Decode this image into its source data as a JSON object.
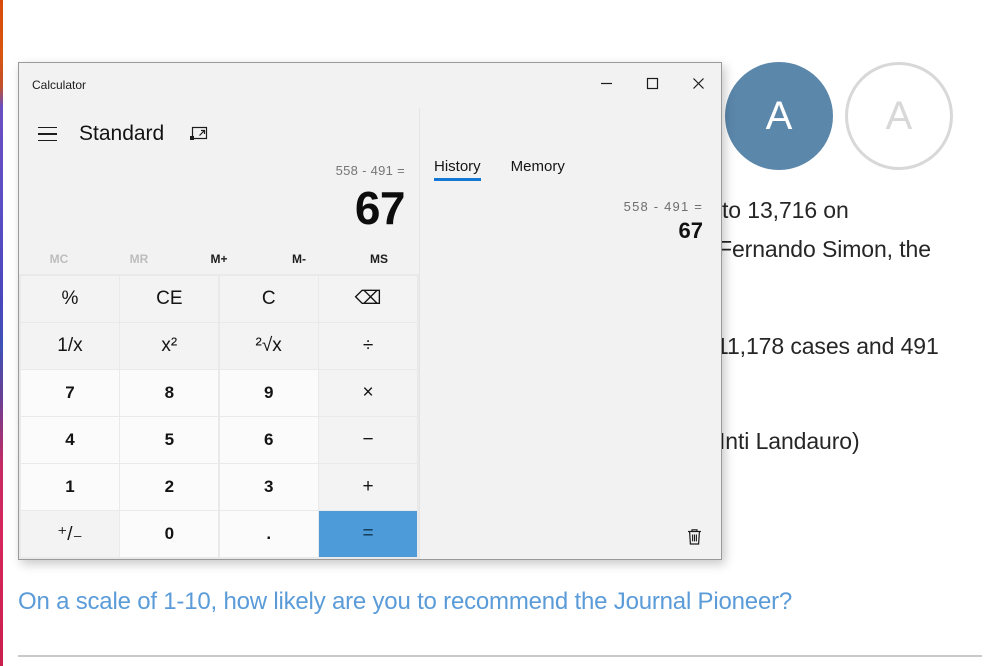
{
  "background": {
    "avatars": [
      {
        "initial": "A",
        "style": "filled"
      },
      {
        "initial": "A",
        "style": "outline"
      }
    ],
    "article_lines": [
      "to 13,716 on",
      "Fernando Simon, the",
      "11,178 cases and 491",
      "Inti Landauro)"
    ],
    "survey_question": "On a scale of 1-10, how likely are you to recommend the Journal Pioneer?",
    "accent_blue": "#5a9bd8"
  },
  "calculator": {
    "window_caption": "Calculator",
    "window_controls": {
      "minimize": "minimize-icon",
      "maximize": "maximize-icon",
      "close": "close-icon"
    },
    "menu_icon": "hamburger-menu-icon",
    "mode": "Standard",
    "keypad_toggle_icon": "keypad-toggle-icon",
    "display": {
      "expression": "558 - 491 =",
      "result": "67"
    },
    "memory_buttons": [
      {
        "label": "MC",
        "enabled": false
      },
      {
        "label": "MR",
        "enabled": false
      },
      {
        "label": "M+",
        "enabled": true
      },
      {
        "label": "M-",
        "enabled": true
      },
      {
        "label": "MS",
        "enabled": true
      }
    ],
    "keys": [
      {
        "label": "%",
        "type": "op",
        "name": "percent"
      },
      {
        "label": "CE",
        "type": "op",
        "name": "clear-entry"
      },
      {
        "label": "C",
        "type": "op",
        "name": "clear"
      },
      {
        "label": "⌫",
        "type": "op",
        "name": "backspace"
      },
      {
        "label": "1/x",
        "type": "op",
        "name": "reciprocal"
      },
      {
        "label": "x²",
        "type": "op",
        "name": "square"
      },
      {
        "label": "²√x",
        "type": "op",
        "name": "square-root"
      },
      {
        "label": "÷",
        "type": "op",
        "name": "divide"
      },
      {
        "label": "7",
        "type": "num",
        "name": "seven"
      },
      {
        "label": "8",
        "type": "num",
        "name": "eight"
      },
      {
        "label": "9",
        "type": "num",
        "name": "nine"
      },
      {
        "label": "×",
        "type": "op",
        "name": "multiply"
      },
      {
        "label": "4",
        "type": "num",
        "name": "four"
      },
      {
        "label": "5",
        "type": "num",
        "name": "five"
      },
      {
        "label": "6",
        "type": "num",
        "name": "six"
      },
      {
        "label": "−",
        "type": "op",
        "name": "subtract"
      },
      {
        "label": "1",
        "type": "num",
        "name": "one"
      },
      {
        "label": "2",
        "type": "num",
        "name": "two"
      },
      {
        "label": "3",
        "type": "num",
        "name": "three"
      },
      {
        "label": "+",
        "type": "op",
        "name": "add"
      },
      {
        "label": "⁺/₋",
        "type": "op",
        "name": "negate"
      },
      {
        "label": "0",
        "type": "num",
        "name": "zero"
      },
      {
        "label": ".",
        "type": "num",
        "name": "decimal"
      },
      {
        "label": "=",
        "type": "equals",
        "name": "equals"
      }
    ],
    "equals_color": "#4d9bd8",
    "history_panel": {
      "tabs": [
        {
          "label": "History",
          "active": true
        },
        {
          "label": "Memory",
          "active": false
        }
      ],
      "tab_underline_color": "#1277d5",
      "entries": [
        {
          "expression": "558  -  491 =",
          "result": "67"
        }
      ],
      "clear_icon": "trash-icon"
    }
  }
}
